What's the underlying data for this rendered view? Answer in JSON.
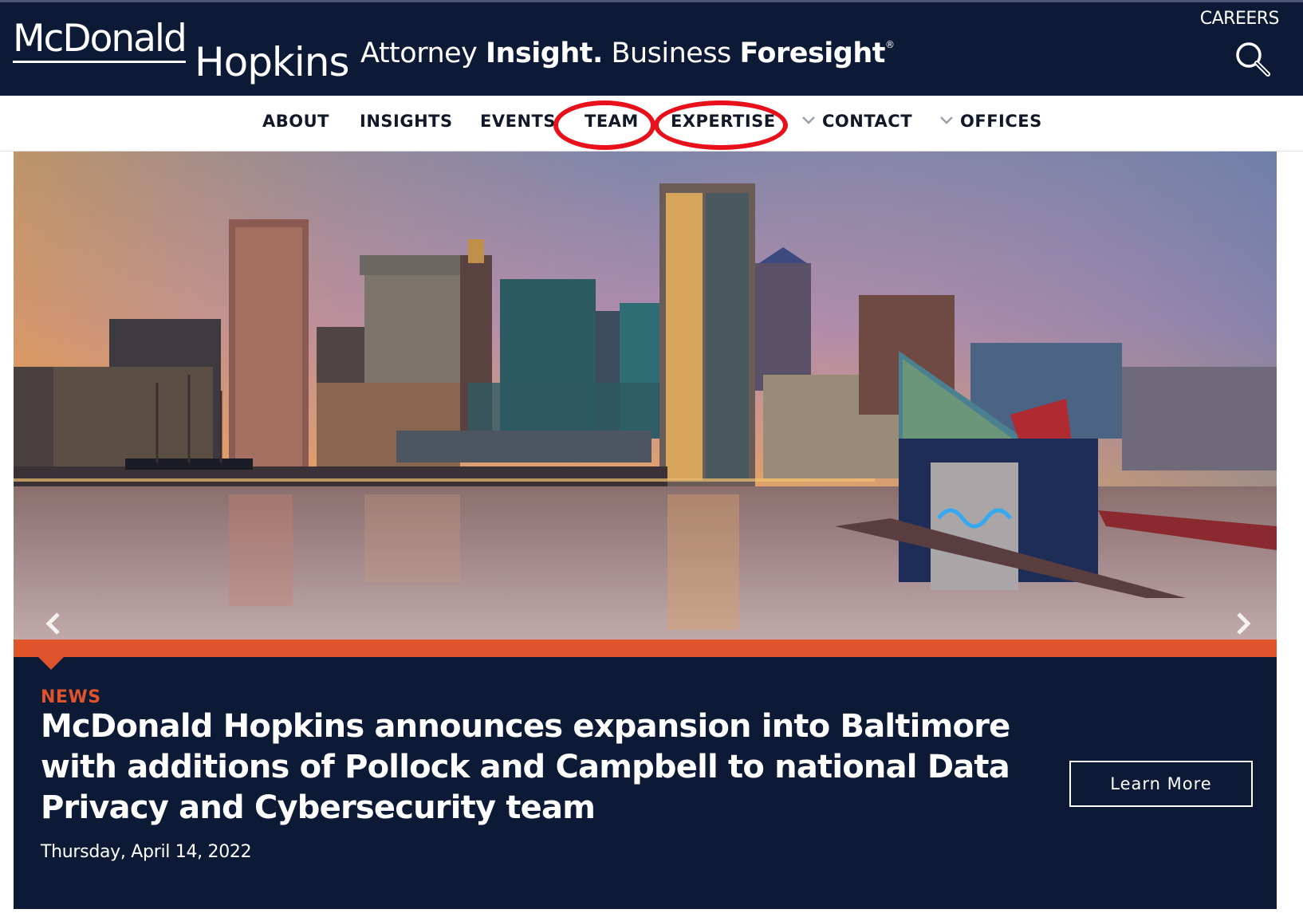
{
  "header": {
    "logo_top": "McDonald",
    "logo_bottom": "Hopkins",
    "tagline_1": "Attorney",
    "tagline_2": "Insight.",
    "tagline_3": "Business",
    "tagline_4": "Foresight",
    "tagline_mark": "®",
    "careers": "CAREERS",
    "search_icon": "search-icon",
    "bg_color": "#0d1a36"
  },
  "nav": {
    "items": [
      {
        "label": "ABOUT"
      },
      {
        "label": "INSIGHTS"
      },
      {
        "label": "EVENTS"
      },
      {
        "label": "TEAM"
      },
      {
        "label": "EXPERTISE"
      },
      {
        "label": "CONTACT"
      },
      {
        "label": "OFFICES"
      }
    ],
    "annotation_color": "#e8101a"
  },
  "hero": {
    "prev_icon": "chevron-left-icon",
    "next_icon": "chevron-right-icon",
    "accent_color": "#e0542b"
  },
  "news": {
    "label": "NEWS",
    "headline": "McDonald Hopkins announces expansion into Baltimore with additions of Pollock and Campbell to national Data Privacy and Cybersecurity team",
    "date": "Thursday, April 14, 2022",
    "button": "Learn More"
  }
}
